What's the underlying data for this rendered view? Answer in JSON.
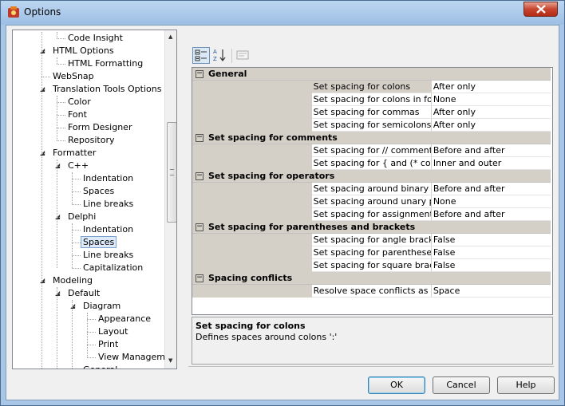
{
  "window": {
    "title": "Options"
  },
  "tree": [
    {
      "label": "Code Insight",
      "level": 2
    },
    {
      "label": "HTML Options",
      "level": 1,
      "expanded": true
    },
    {
      "label": "HTML Formatting",
      "level": 2
    },
    {
      "label": "WebSnap",
      "level": 1
    },
    {
      "label": "Translation Tools Options",
      "level": 1,
      "expanded": true
    },
    {
      "label": "Color",
      "level": 2
    },
    {
      "label": "Font",
      "level": 2
    },
    {
      "label": "Form Designer",
      "level": 2
    },
    {
      "label": "Repository",
      "level": 2
    },
    {
      "label": "Formatter",
      "level": 1,
      "expanded": true
    },
    {
      "label": "C++",
      "level": 2,
      "expanded": true
    },
    {
      "label": "Indentation",
      "level": 3
    },
    {
      "label": "Spaces",
      "level": 3
    },
    {
      "label": "Line breaks",
      "level": 3
    },
    {
      "label": "Delphi",
      "level": 2,
      "expanded": true
    },
    {
      "label": "Indentation",
      "level": 3
    },
    {
      "label": "Spaces",
      "level": 3,
      "selected": true
    },
    {
      "label": "Line breaks",
      "level": 3
    },
    {
      "label": "Capitalization",
      "level": 3
    },
    {
      "label": "Modeling",
      "level": 1,
      "expanded": true
    },
    {
      "label": "Default",
      "level": 2,
      "expanded": true
    },
    {
      "label": "Diagram",
      "level": 3,
      "expanded": true
    },
    {
      "label": "Appearance",
      "level": 4
    },
    {
      "label": "Layout",
      "level": 4
    },
    {
      "label": "Print",
      "level": 4
    },
    {
      "label": "View Management",
      "level": 4
    },
    {
      "label": "General",
      "level": 3
    }
  ],
  "grid": {
    "sections": [
      {
        "title": "General",
        "rows": [
          {
            "name": "Set spacing for colons",
            "value": "After only",
            "selected": true
          },
          {
            "name": "Set spacing for colons in format",
            "value": "None"
          },
          {
            "name": "Set spacing for commas",
            "value": "After only"
          },
          {
            "name": "Set spacing for semicolons",
            "value": "After only"
          }
        ]
      },
      {
        "title": "Set spacing for comments",
        "rows": [
          {
            "name": "Set spacing for // comments",
            "value": "Before and after"
          },
          {
            "name": "Set spacing for { and (* comments",
            "value": "Inner and outer"
          }
        ]
      },
      {
        "title": "Set spacing for operators",
        "rows": [
          {
            "name": "Set spacing around binary operators",
            "value": "Before and after"
          },
          {
            "name": "Set spacing around unary prefix operators",
            "value": "None"
          },
          {
            "name": "Set spacing for assignment operators",
            "value": "Before and after"
          }
        ]
      },
      {
        "title": "Set spacing for parentheses and brackets",
        "rows": [
          {
            "name": "Set spacing for angle brackets in generics",
            "value": "False"
          },
          {
            "name": "Set spacing for parentheses",
            "value": "False"
          },
          {
            "name": "Set spacing for square brackets",
            "value": "False"
          }
        ]
      },
      {
        "title": "Spacing conflicts",
        "rows": [
          {
            "name": "Resolve space conflicts as",
            "value": "Space"
          }
        ]
      }
    ]
  },
  "description": {
    "title": "Set spacing for colons",
    "text": "Defines spaces around colons ':'"
  },
  "buttons": {
    "ok": "OK",
    "cancel": "Cancel",
    "help": "Help"
  },
  "icons": {
    "close": "close-icon",
    "categorized": "categorized-icon",
    "sort": "sort-alphabetical-icon",
    "pages": "property-pages-icon"
  }
}
